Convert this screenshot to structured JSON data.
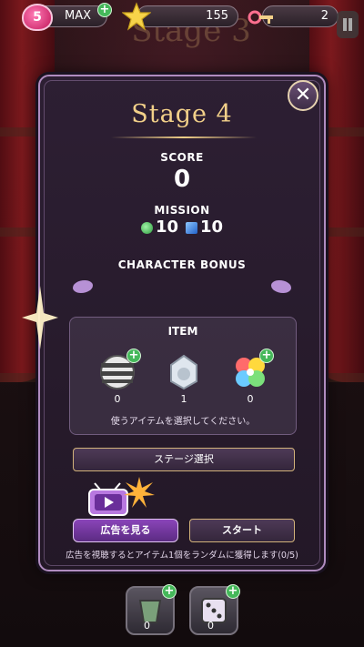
{
  "hud": {
    "hearts": "5",
    "lives_label": "MAX",
    "stars": "155",
    "keys": "2"
  },
  "background": {
    "title": "Stage 3"
  },
  "panel": {
    "title": "Stage 4",
    "score_label": "SCORE",
    "score_value": "0",
    "mission_label": "MISSION",
    "mission_green": "10",
    "mission_blue": "10",
    "character_bonus_label": "CHARACTER BONUS",
    "item": {
      "title": "ITEM",
      "items": [
        {
          "name": "striped-ball",
          "count": "0"
        },
        {
          "name": "ice-ring",
          "count": "1"
        },
        {
          "name": "rainbow-clover",
          "count": "0"
        }
      ],
      "hint": "使うアイテムを選択してください。"
    },
    "stage_select_label": "ステージ選択",
    "watch_ad_label": "広告を見る",
    "start_label": "スタート",
    "ad_note": "広告を視聴するとアイテム1個をランダムに獲得します(0/5)"
  },
  "bottom_items": [
    {
      "name": "bucket-booster",
      "count": "0"
    },
    {
      "name": "dice-booster",
      "count": "0"
    }
  ],
  "colors": {
    "accent_gold": "#f2d089",
    "panel_bg": "#2d1f33",
    "ad_button": "#8a45b9",
    "plus_green": "#45b85a"
  }
}
